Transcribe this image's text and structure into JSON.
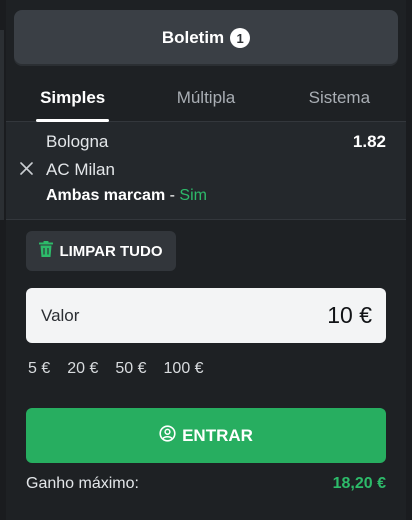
{
  "header": {
    "title": "Boletim",
    "count": "1"
  },
  "tabs": [
    {
      "label": "Simples",
      "active": true
    },
    {
      "label": "Múltipla",
      "active": false
    },
    {
      "label": "Sistema",
      "active": false
    }
  ],
  "bet": {
    "home_team": "Bologna",
    "away_team": "AC Milan",
    "odds": "1.82",
    "market": "Ambas marcam",
    "separator": "-",
    "selection": "Sim"
  },
  "actions": {
    "clear_label": "LIMPAR TUDO",
    "enter_label": "ENTRAR"
  },
  "stake": {
    "label": "Valor",
    "value": "10 €"
  },
  "quick_amounts": [
    "5 €",
    "20 €",
    "50 €",
    "100 €"
  ],
  "summary": {
    "max_gain_label": "Ganho máximo:",
    "max_gain_value": "18,20 €"
  },
  "colors": {
    "accent": "#27ae60",
    "selection": "#2dbb6a",
    "background": "#1e2124"
  },
  "icons": {
    "close": "close-icon",
    "trash": "trash-icon",
    "user": "user-circle-icon"
  }
}
